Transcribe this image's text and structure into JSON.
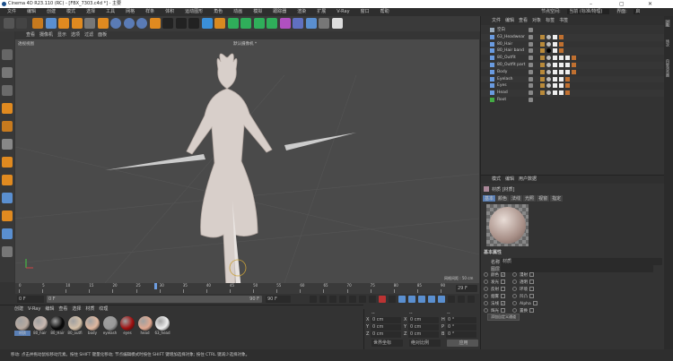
{
  "window": {
    "title": "Cinema 4D R23.110 (RC) - [FBX_7303.c4d *] - 主要",
    "minimize": "–",
    "maximize": "▢",
    "close": "✕"
  },
  "menu": [
    "文件",
    "编辑",
    "创建",
    "模式",
    "选择",
    "工具",
    "网格",
    "样条",
    "体积",
    "运动图形",
    "角色",
    "动画",
    "模拟",
    "跟踪器",
    "渲染",
    "扩展",
    "V-Ray",
    "窗口",
    "帮助"
  ],
  "nodespace": {
    "label": "节点空间:",
    "value": "当前 (标准/物理)",
    "layout_label": "界面:",
    "layout_value": "启动"
  },
  "viewport": {
    "menu": [
      "查看",
      "摄像机",
      "显示",
      "选项",
      "过滤",
      "面板"
    ],
    "name": "透视视图",
    "camera": "默认摄像机 *",
    "grid": "网格间距 : 50 cm"
  },
  "timeline": {
    "ticks": [
      "0",
      "5",
      "10",
      "15",
      "20",
      "25",
      "30",
      "35",
      "40",
      "45",
      "50",
      "55",
      "60",
      "65",
      "70",
      "75",
      "80",
      "85",
      "90"
    ],
    "current_frame": 29,
    "current": "29 F",
    "max": 90,
    "start": "0 F",
    "range_start": "0 F",
    "range_end": "90 F",
    "end": "90 F"
  },
  "materials": {
    "menu": [
      "创建",
      "V-Ray",
      "编辑",
      "查看",
      "选择",
      "材质",
      "纹理"
    ],
    "items": [
      {
        "name": "材质",
        "color": "#b9aaa0"
      },
      {
        "name": "80_hair",
        "color": "#c8b8b0"
      },
      {
        "name": "80_Hair",
        "color": "#0a0a0a"
      },
      {
        "name": "80_outfi",
        "color": "#d4c0a8"
      },
      {
        "name": "body",
        "color": "#e0b8a0"
      },
      {
        "name": "eyelash",
        "color": "#999"
      },
      {
        "name": "eyes",
        "color": "#a01010"
      },
      {
        "name": "head",
        "color": "#e0a890"
      },
      {
        "name": "63_head",
        "color": "#eeeeee"
      }
    ]
  },
  "coords": {
    "headers": [
      "--",
      "--",
      "--"
    ],
    "rows": [
      [
        "X",
        "0 cm",
        "X",
        "0 cm",
        "H",
        "0 °"
      ],
      [
        "Y",
        "0 cm",
        "Y",
        "0 cm",
        "P",
        "0 °"
      ],
      [
        "Z",
        "0 cm",
        "Z",
        "0 cm",
        "B",
        "0 °"
      ]
    ],
    "mode": "世界坐标",
    "scale": "绝对比例",
    "apply": "应用"
  },
  "status": "移动: 点击并拖动鼠标移动元素。按住 SHIFT 键量化移动; 节点编辑模式时按住 SHIFT 键增加选择对象; 按住 CTRL 键减少选择对象。",
  "objects": {
    "menu": [
      "文件",
      "编辑",
      "查看",
      "对象",
      "标签",
      "书签"
    ],
    "items": [
      {
        "name": "空白",
        "tags": 0
      },
      {
        "name": "63_Headwear",
        "tags": 2
      },
      {
        "name": "80_Hair",
        "tags": 2
      },
      {
        "name": "80_Hair band",
        "tags": 2
      },
      {
        "name": "80_Outfit",
        "tags": 4
      },
      {
        "name": "80_Outfit part",
        "tags": 4
      },
      {
        "name": "Body",
        "tags": 4
      },
      {
        "name": "Eyelash",
        "tags": 3
      },
      {
        "name": "Eyes",
        "tags": 3
      },
      {
        "name": "Head",
        "tags": 3
      },
      {
        "name": "Root",
        "tags": 0
      }
    ]
  },
  "attributes": {
    "menu": [
      "模式",
      "编辑",
      "用户数据"
    ],
    "title": "材质 [材质]",
    "tabs": [
      "基本",
      "颜色",
      "法线",
      "光照",
      "视窗",
      "指定"
    ],
    "section": "基本属性",
    "name_label": "名称",
    "name_value": "材质",
    "layer_label": "图层",
    "channels_left": [
      {
        "label": "颜色",
        "checked": true
      },
      {
        "label": "发光",
        "checked": false
      },
      {
        "label": "反射",
        "checked": false
      },
      {
        "label": "烟雾",
        "checked": false
      },
      {
        "label": "法线",
        "checked": true
      },
      {
        "label": "辉光",
        "checked": false
      }
    ],
    "channels_right": [
      {
        "label": "漫射",
        "checked": false
      },
      {
        "label": "透明",
        "checked": false
      },
      {
        "label": "环境",
        "checked": false
      },
      {
        "label": "凹凸",
        "checked": false
      },
      {
        "label": "Alpha",
        "checked": false
      },
      {
        "label": "置换",
        "checked": false
      }
    ],
    "add_channel": "添加自定义通道"
  },
  "sidetabs": [
    "对象",
    "场次",
    "内容浏览器"
  ]
}
